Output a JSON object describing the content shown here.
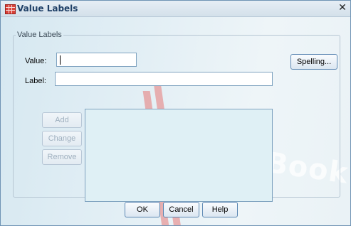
{
  "window": {
    "title": "Value Labels",
    "icon": "spss-data-icon",
    "close_glyph": "✕"
  },
  "group": {
    "legend": "Value Labels",
    "value_label": "Value:",
    "value_field": "",
    "label_label": "Label:",
    "label_field": "",
    "spelling_button": "Spelling...",
    "add_button": "Add",
    "change_button": "Change",
    "remove_button": "Remove",
    "list_items": []
  },
  "footer": {
    "ok_button": "OK",
    "cancel_button": "Cancel",
    "help_button": "Help"
  },
  "watermark": {
    "text": "DropBook"
  },
  "colors": {
    "title_text": "#1e3f66",
    "background": "#dfedf4",
    "listbox": "#dff0f5",
    "button_border": "#5d88b3",
    "disabled_text": "#9fb0bf",
    "watermark_bar": "#e8332d"
  }
}
